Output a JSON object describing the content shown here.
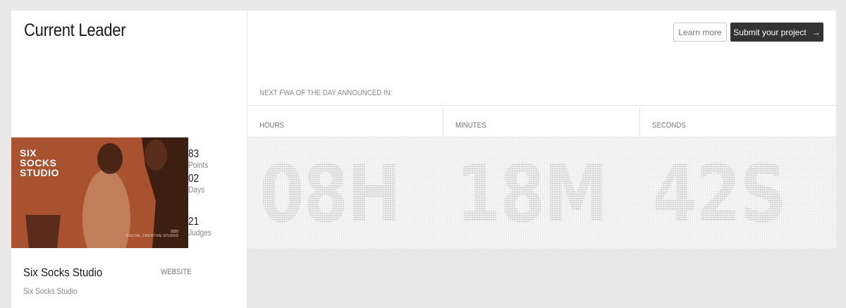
{
  "leader": {
    "title": "Current Leader",
    "thumbnail": {
      "logo_lines": [
        "SIX",
        "SOCKS",
        "STUDIO"
      ],
      "year": "2020",
      "subtitle": "DIGITAL CREATIVE STUDIO",
      "background_color": "#a85230"
    },
    "stats": [
      {
        "value": "83",
        "label": "Points"
      },
      {
        "value": "02",
        "label": "Days"
      },
      {
        "value": "21",
        "label": "Judges"
      }
    ],
    "studio_name": "Six Socks Studio",
    "studio_sub": "Six Socks Studio",
    "category": "WEBSITE"
  },
  "header": {
    "learn_more": "Learn more",
    "submit_project": "Submit your project",
    "submit_icon": "arrow-right-icon",
    "accent_dark": "#333333"
  },
  "countdown": {
    "announce_label": "NEXT FWA OF THE DAY ANNOUNCED IN:",
    "units": [
      {
        "label": "HOURS",
        "display": "08H"
      },
      {
        "label": "MINUTES",
        "display": "18M"
      },
      {
        "label": "SECONDS",
        "display": "42S"
      }
    ]
  }
}
